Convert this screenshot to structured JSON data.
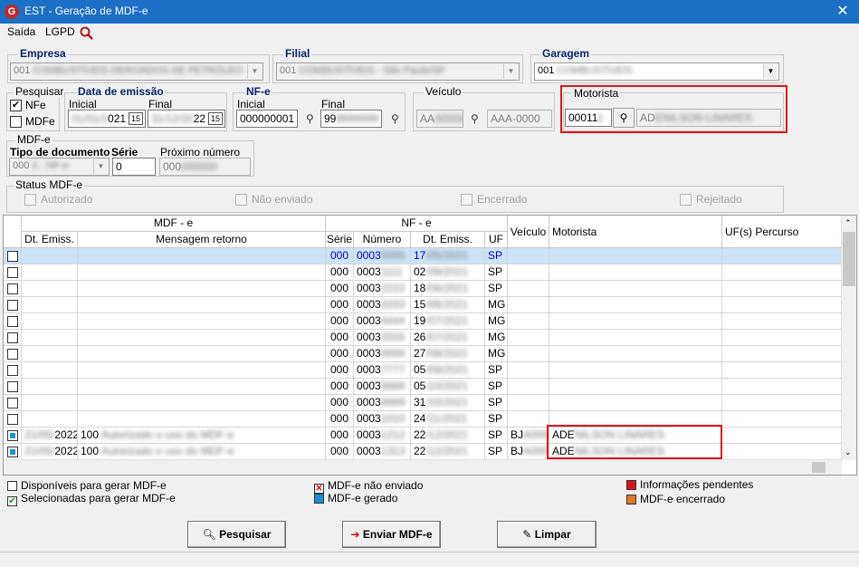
{
  "window": {
    "title": "EST - Geração de MDF-e",
    "close": "✕"
  },
  "menu": {
    "items": [
      "Saída",
      "LGPD"
    ]
  },
  "empresa": {
    "label": "Empresa",
    "value": "001",
    "blurred": "COMBUSTÍVEIS DERIVADOS DE PETRÓLEO"
  },
  "filial": {
    "label": "Filial",
    "value": "001",
    "blurred": "COMBUSTÍVEIS - São Paulo/SP"
  },
  "garagem": {
    "label": "Garagem",
    "value": "001",
    "blurred": "COMBUSTÍVEIS"
  },
  "pesquisar": {
    "label": "Pesquisar",
    "nfe": "NFe",
    "mdfe": "MDFe",
    "nfe_checked": "✔"
  },
  "data_emissao": {
    "label": "Data de emissão",
    "inicial_label": "Inicial",
    "final_label": "Final",
    "inicial_suffix": "021",
    "final_suffix": "22",
    "inicial_blur": "01/01/2",
    "final_blur": "31/12/20"
  },
  "nfe": {
    "label": "NF-e",
    "inicial_label": "Inicial",
    "final_label": "Final",
    "inicial_value": "000000001",
    "final_value": "99",
    "final_blur": "9999999"
  },
  "veiculo": {
    "label": "Veículo",
    "plate_prefix": "AA",
    "plate_blur": "A0000",
    "placeholder": "AAA-0000"
  },
  "motorista": {
    "label": "Motorista",
    "code": "00011",
    "code_blur": "1",
    "name_prefix": "AD",
    "name_blur": "ENILSON LINARES"
  },
  "mdfe_group": {
    "label": "MDF-e",
    "tipo_label": "Tipo de documento",
    "serie_label": "Série",
    "serie_value": "0",
    "proximo_label": "Próximo número",
    "tipo_value": "000",
    "tipo_blur": "0 - NF-e",
    "proximo_value": "000",
    "proximo_blur": "000000"
  },
  "status_mdfe": {
    "label": "Status MDF-e",
    "items": [
      "Autorizado",
      "Não enviado",
      "Encerrado",
      "Rejeitado"
    ]
  },
  "grid": {
    "group_headers": [
      "MDF - e",
      "NF - e"
    ],
    "columns": [
      "Dt. Emiss.",
      "Mensagem retorno",
      "Série",
      "Número",
      "Dt. Emiss.",
      "UF",
      "Veículo",
      "Motorista",
      "UF(s) Percurso"
    ],
    "rows": [
      {
        "dt_mdfe": "",
        "msg": "",
        "serie": "000",
        "numero": "0003",
        "num_blur": "0000",
        "dt_nfe": "17",
        "dt_blur": "/05/2021",
        "uf": "SP",
        "veiculo": "",
        "vei_blur": "",
        "motorista": "",
        "mot_blur": "",
        "selected": true,
        "mdfe": false
      },
      {
        "dt_mdfe": "",
        "msg": "",
        "serie": "000",
        "numero": "0003",
        "num_blur": "1111",
        "dt_nfe": "02",
        "dt_blur": "/06/2021",
        "uf": "SP",
        "veiculo": "",
        "vei_blur": "",
        "motorista": "",
        "mot_blur": "",
        "selected": false,
        "mdfe": false
      },
      {
        "dt_mdfe": "",
        "msg": "",
        "serie": "000",
        "numero": "0003",
        "num_blur": "2222",
        "dt_nfe": "18",
        "dt_blur": "/06/2021",
        "uf": "SP",
        "veiculo": "",
        "vei_blur": "",
        "motorista": "",
        "mot_blur": "",
        "selected": false,
        "mdfe": false
      },
      {
        "dt_mdfe": "",
        "msg": "",
        "serie": "000",
        "numero": "0003",
        "num_blur": "3333",
        "dt_nfe": "15",
        "dt_blur": "/06/2021",
        "uf": "MG",
        "veiculo": "",
        "vei_blur": "",
        "motorista": "",
        "mot_blur": "",
        "selected": false,
        "mdfe": false
      },
      {
        "dt_mdfe": "",
        "msg": "",
        "serie": "000",
        "numero": "0003",
        "num_blur": "4444",
        "dt_nfe": "19",
        "dt_blur": "/07/2021",
        "uf": "MG",
        "veiculo": "",
        "vei_blur": "",
        "motorista": "",
        "mot_blur": "",
        "selected": false,
        "mdfe": false
      },
      {
        "dt_mdfe": "",
        "msg": "",
        "serie": "000",
        "numero": "0003",
        "num_blur": "5555",
        "dt_nfe": "26",
        "dt_blur": "/07/2021",
        "uf": "MG",
        "veiculo": "",
        "vei_blur": "",
        "motorista": "",
        "mot_blur": "",
        "selected": false,
        "mdfe": false
      },
      {
        "dt_mdfe": "",
        "msg": "",
        "serie": "000",
        "numero": "0003",
        "num_blur": "6666",
        "dt_nfe": "27",
        "dt_blur": "/08/2021",
        "uf": "MG",
        "veiculo": "",
        "vei_blur": "",
        "motorista": "",
        "mot_blur": "",
        "selected": false,
        "mdfe": false
      },
      {
        "dt_mdfe": "",
        "msg": "",
        "serie": "000",
        "numero": "0003",
        "num_blur": "7777",
        "dt_nfe": "05",
        "dt_blur": "/09/2021",
        "uf": "SP",
        "veiculo": "",
        "vei_blur": "",
        "motorista": "",
        "mot_blur": "",
        "selected": false,
        "mdfe": false
      },
      {
        "dt_mdfe": "",
        "msg": "",
        "serie": "000",
        "numero": "0003",
        "num_blur": "8888",
        "dt_nfe": "05",
        "dt_blur": "/10/2021",
        "uf": "SP",
        "veiculo": "",
        "vei_blur": "",
        "motorista": "",
        "mot_blur": "",
        "selected": false,
        "mdfe": false
      },
      {
        "dt_mdfe": "",
        "msg": "",
        "serie": "000",
        "numero": "0003",
        "num_blur": "9999",
        "dt_nfe": "31",
        "dt_blur": "/10/2021",
        "uf": "SP",
        "veiculo": "",
        "vei_blur": "",
        "motorista": "",
        "mot_blur": "",
        "selected": false,
        "mdfe": false
      },
      {
        "dt_mdfe": "",
        "msg": "",
        "serie": "000",
        "numero": "0003",
        "num_blur": "1010",
        "dt_nfe": "24",
        "dt_blur": "/11/2021",
        "uf": "SP",
        "veiculo": "",
        "vei_blur": "",
        "motorista": "",
        "mot_blur": "",
        "selected": false,
        "mdfe": false
      },
      {
        "dt_mdfe": "2022",
        "mdfe_blur": "21/05/",
        "msg": "100",
        "msg_blur": "Autorizado o uso do MDF-e",
        "serie": "000",
        "numero": "0003",
        "num_blur": "1212",
        "dt_nfe": "22",
        "dt_blur": "/12/2021",
        "uf": "SP",
        "veiculo": "BJ",
        "vei_blur": "A0000",
        "motorista": "ADE",
        "mot_blur": "NILSON LINARES",
        "selected": false,
        "mdfe": true
      },
      {
        "dt_mdfe": "2022",
        "mdfe_blur": "21/05/",
        "msg": "100",
        "msg_blur": "Autorizado o uso do MDF-e",
        "serie": "000",
        "numero": "0003",
        "num_blur": "1313",
        "dt_nfe": "22",
        "dt_blur": "/12/2021",
        "uf": "SP",
        "veiculo": "BJ",
        "vei_blur": "A0000",
        "motorista": "ADE",
        "mot_blur": "NILSON LINARES",
        "selected": false,
        "mdfe": true
      }
    ]
  },
  "legend": {
    "disponiveis": "Disponíveis para gerar MDF-e",
    "selecionadas": "Selecionadas para gerar MDF-e",
    "nao_enviado": "MDF-e não enviado",
    "gerado": "MDF-e gerado",
    "pendentes": "Informações pendentes",
    "encerrado": "MDF-e encerrado"
  },
  "buttons": {
    "pesquisar": "Pesquisar",
    "enviar": "Enviar MDF-e",
    "limpar": "Limpar"
  },
  "colors": {
    "accent": "#1c6fc4",
    "highlight": "#e0151c",
    "gerado": "#1e90d6",
    "pendentes": "#d81818",
    "encerrado": "#e07a20"
  }
}
